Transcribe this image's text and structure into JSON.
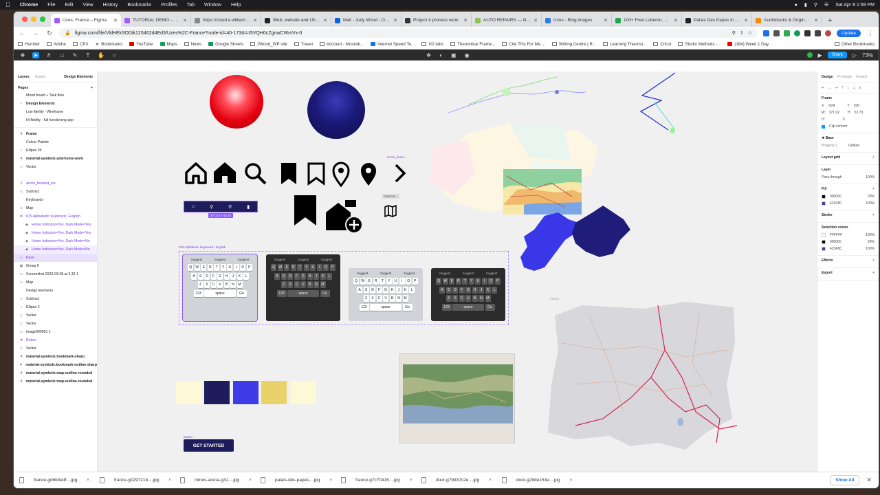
{
  "menubar": {
    "app": "Chrome",
    "items": [
      "File",
      "Edit",
      "View",
      "History",
      "Bookmarks",
      "Profiles",
      "Tab",
      "Window",
      "Help"
    ],
    "datetime": "Sat Apr 8  1:59 PM"
  },
  "tabs": [
    {
      "label": "Uzes, France – Figma",
      "active": true,
      "color": "#a259ff"
    },
    {
      "label": "TUTORIAL DEMO – Figma",
      "active": false,
      "color": "#a259ff"
    },
    {
      "label": "https://cloud.e.williams-s",
      "active": false,
      "color": "#888888"
    },
    {
      "label": "Web, website and UI/UX",
      "active": false,
      "color": "#222222"
    },
    {
      "label": "Mail - Judy Wood - Outlo",
      "active": false,
      "color": "#0a64d6"
    },
    {
      "label": "Project 4 process work",
      "active": false,
      "color": "#333333"
    },
    {
      "label": "AUTO REPAIRS — Nextdo",
      "active": false,
      "color": "#8bc34a"
    },
    {
      "label": "Uzes - Bing images",
      "active": false,
      "color": "#2a7de1"
    },
    {
      "label": "100+ Free Luberon, Franc",
      "active": false,
      "color": "#20a84a"
    },
    {
      "label": "Palais Des Papes In Avigr",
      "active": false,
      "color": "#222222"
    },
    {
      "label": "Audiobooks & Original Au",
      "active": false,
      "color": "#f28b00"
    }
  ],
  "address": {
    "url": "figma.com/file/VldHEkSDDik11S462d4Ed3/Uzes%2C-France?node-id=40-173&t=I5VQH0cZgnwCWmVx-0",
    "update_label": "Update"
  },
  "bookmarks": [
    {
      "label": "Humber",
      "kind": "folder"
    },
    {
      "label": "Adobe",
      "kind": "folder"
    },
    {
      "label": "CPX",
      "kind": "folder"
    },
    {
      "label": "Bookmarks",
      "kind": "star"
    },
    {
      "label": "YouTube",
      "kind": "y"
    },
    {
      "label": "Maps",
      "kind": "g"
    },
    {
      "label": "News",
      "kind": "folder"
    },
    {
      "label": "Google Sheets",
      "kind": "g"
    },
    {
      "label": "JWood_WP site",
      "kind": "folder"
    },
    {
      "label": "Travel",
      "kind": "folder"
    },
    {
      "label": "Account - Muskok...",
      "kind": "folder"
    },
    {
      "label": "Internet Speed Te...",
      "kind": "b"
    },
    {
      "label": "XD tabs",
      "kind": "folder"
    },
    {
      "label": "Theoretical Frame...",
      "kind": "folder"
    },
    {
      "label": "Cite This For Me:...",
      "kind": "folder"
    },
    {
      "label": "Writing Centre | R...",
      "kind": "folder"
    },
    {
      "label": "Learning Theorist...",
      "kind": "folder"
    },
    {
      "label": "Cricut",
      "kind": "folder"
    },
    {
      "label": "Studio Methods -...",
      "kind": "folder"
    },
    {
      "label": "(184) Week 1 Day...",
      "kind": "y"
    },
    {
      "label": "Other Bookmarks",
      "kind": "folder"
    }
  ],
  "figma": {
    "share_label": "Share",
    "zoom": "73%",
    "left_panel": {
      "tab_layers": "Layers",
      "tab_assets": "Assets",
      "page_switch": "Design Elements",
      "pages_title": "Pages",
      "pages": [
        {
          "label": "Mood board + Task flow",
          "checked": false
        },
        {
          "label": "Design Elements",
          "checked": true
        },
        {
          "label": "Low fidelity - Wireframe",
          "checked": false
        },
        {
          "label": "Hi fidelity - full functioning app",
          "checked": false
        }
      ],
      "layers": [
        {
          "label": "Frame",
          "icon": "#",
          "style": "bold",
          "level": 0
        },
        {
          "label": "Colour Palette",
          "icon": "",
          "style": "",
          "level": 0
        },
        {
          "label": "Ellipse 36",
          "icon": "○",
          "style": "",
          "level": 0
        },
        {
          "label": "material-symbols:add-home-work",
          "icon": "#",
          "style": "bold",
          "level": 0
        },
        {
          "label": "Vector",
          "icon": "◇",
          "style": "",
          "level": 0
        },
        {
          "label": "",
          "icon": "",
          "style": "",
          "level": 0
        },
        {
          "label": "arrow_forward_ios",
          "icon": "#",
          "style": "purple",
          "level": 0
        },
        {
          "label": "Subtract",
          "icon": "◇",
          "style": "",
          "level": 0
        },
        {
          "label": "Keyboards",
          "icon": "",
          "style": "",
          "level": 0
        },
        {
          "label": "Map",
          "icon": "▭",
          "style": "",
          "level": 0
        },
        {
          "label": "iOS Alphabetic Keyboard / English",
          "icon": "❖",
          "style": "purple",
          "level": 0
        },
        {
          "label": "Home Indicator=Yes, Dark Mode=Yes",
          "icon": "◆",
          "style": "purple",
          "level": 1
        },
        {
          "label": "Home Indicator=Yes, Dark Mode=Yes",
          "icon": "◆",
          "style": "purple",
          "level": 1
        },
        {
          "label": "Home Indicator=Yes, Dark Mode=No",
          "icon": "◆",
          "style": "purple",
          "level": 1
        },
        {
          "label": "Home Indicator=Yes, Dark Mode=No",
          "icon": "◆",
          "style": "purple sel2",
          "level": 1
        },
        {
          "label": "Base",
          "icon": "◇",
          "style": "purple sel",
          "level": 0
        },
        {
          "label": "Group 6",
          "icon": "▦",
          "style": "",
          "level": 0
        },
        {
          "label": "Screenshot 2023-03-08 at 2.32 1",
          "icon": "▭",
          "style": "",
          "level": 0
        },
        {
          "label": "Map",
          "icon": "▭",
          "style": "",
          "level": 0
        },
        {
          "label": "Design Elements",
          "icon": "",
          "style": "",
          "level": 0
        },
        {
          "label": "Subtract",
          "icon": "◇",
          "style": "",
          "level": 0
        },
        {
          "label": "Ellipse 2",
          "icon": "○",
          "style": "",
          "level": 0
        },
        {
          "label": "Vector",
          "icon": "◇",
          "style": "",
          "level": 0
        },
        {
          "label": "Vector",
          "icon": "◇",
          "style": "",
          "level": 0
        },
        {
          "label": "image000001 1",
          "icon": "▭",
          "style": "",
          "level": 0
        },
        {
          "label": "Button",
          "icon": "❖",
          "style": "purple",
          "level": 0
        },
        {
          "label": "Vector",
          "icon": "◇",
          "style": "",
          "level": 0
        },
        {
          "label": "material-symbols:bookmark-sharp",
          "icon": "#",
          "style": "bold",
          "level": 0
        },
        {
          "label": "material-symbols:bookmark-outline-sharp",
          "icon": "#",
          "style": "bold",
          "level": 0
        },
        {
          "label": "material-symbols:map-outline-rounded",
          "icon": "#",
          "style": "bold",
          "level": 0
        },
        {
          "label": "material-symbols:map-outline-rounded",
          "icon": "#",
          "style": "bold",
          "level": 0
        }
      ]
    },
    "right_panel": {
      "tab_design": "Design",
      "tab_prototype": "Prototype",
      "tab_inspect": "Inspect",
      "frame_title": "Frame",
      "x": "-924",
      "y": "206",
      "w": "371.02",
      "h": "52.73",
      "rotation": "0°",
      "radius": "0",
      "clip_content": "Clip content",
      "component_name": "Base",
      "property_label": "Property 1",
      "property_value": "Default",
      "layout_grid": "Layout grid",
      "layer_title": "Layer",
      "blend_mode": "Pass through",
      "layer_opacity": "100%",
      "fill_title": "Fill",
      "fills": [
        {
          "hex": "000000",
          "opacity": "20%",
          "color": "#000000"
        },
        {
          "hex": "423F8C",
          "opacity": "100%",
          "color": "#423F8C"
        }
      ],
      "stroke_title": "Stroke",
      "selection_colors_title": "Selection colors",
      "selection_colors": [
        {
          "hex": "FFFFFF",
          "opacity": "100%",
          "color": "#FFFFFF"
        },
        {
          "hex": "000000",
          "opacity": "20%",
          "color": "#000000"
        },
        {
          "hex": "423F8C",
          "opacity": "100%",
          "color": "#423F8C"
        }
      ],
      "effects_title": "Effects",
      "export_title": "Export"
    },
    "canvas": {
      "keyboard_label": "iOS Alphabetic Keyboard / English",
      "arrow_label": "arrow_forwa...",
      "material_label": "material-...",
      "nav_size_label": "371.02 × 52.73",
      "button_label": "Button",
      "button_text": "GET STARTED",
      "frame_label": "Frame",
      "palette": [
        "#fdf9d8",
        "#1f1c5c",
        "#3e3ce6",
        "#e8d36a",
        "#fdf8d6"
      ],
      "keyboards": [
        {
          "theme": "light",
          "suggest": [
            "Suggest",
            "Suggest",
            "Suggest"
          ],
          "row1": [
            "Q",
            "W",
            "E",
            "R",
            "T",
            "Y",
            "U",
            "I",
            "O",
            "P"
          ],
          "row2": [
            "A",
            "S",
            "D",
            "F",
            "G",
            "H",
            "J",
            "K",
            "L"
          ],
          "row3": [
            "Z",
            "X",
            "C",
            "V",
            "B",
            "N",
            "M"
          ],
          "space": "space",
          "num": "123",
          "go": "Go"
        },
        {
          "theme": "dark",
          "suggest": [
            "Suggest",
            "Suggest",
            "Suggest"
          ],
          "row1": [
            "Q",
            "W",
            "E",
            "R",
            "T",
            "Y",
            "U",
            "I",
            "O",
            "P"
          ],
          "row2": [
            "A",
            "S",
            "D",
            "F",
            "G",
            "H",
            "J",
            "K",
            "L"
          ],
          "row3": [
            "Z",
            "X",
            "C",
            "V",
            "B",
            "N",
            "M"
          ],
          "space": "space",
          "num": "123",
          "go": "Go"
        },
        {
          "theme": "light",
          "suggest": [
            "Suggest",
            "Suggest",
            "Suggest"
          ],
          "row1": [
            "Q",
            "W",
            "E",
            "R",
            "T",
            "Y",
            "U",
            "I",
            "O",
            "P"
          ],
          "row2": [
            "A",
            "S",
            "D",
            "F",
            "G",
            "H",
            "J",
            "K",
            "L"
          ],
          "row3": [
            "Z",
            "X",
            "C",
            "V",
            "B",
            "N",
            "M"
          ],
          "space": "space",
          "num": "123",
          "go": "Go"
        },
        {
          "theme": "dark",
          "suggest": [
            "Suggest",
            "Suggest",
            "Suggest"
          ],
          "row1": [
            "Q",
            "W",
            "E",
            "R",
            "T",
            "Y",
            "U",
            "I",
            "O",
            "P"
          ],
          "row2": [
            "A",
            "S",
            "D",
            "F",
            "G",
            "H",
            "J",
            "K",
            "L"
          ],
          "row3": [
            "Z",
            "X",
            "C",
            "V",
            "B",
            "N",
            "M"
          ],
          "space": "space",
          "num": "123",
          "go": "Go"
        }
      ]
    }
  },
  "downloads": {
    "files": [
      "france-gd6b0edf....jpg",
      "france-g029721b....jpg",
      "nimes-arena-g31....jpg",
      "palais-des-papes....jpg",
      "france-g7c70415....jpg",
      "door-g79d37c2e....jpg",
      "door-g29de153e....jpg"
    ],
    "show_all": "Show All"
  }
}
